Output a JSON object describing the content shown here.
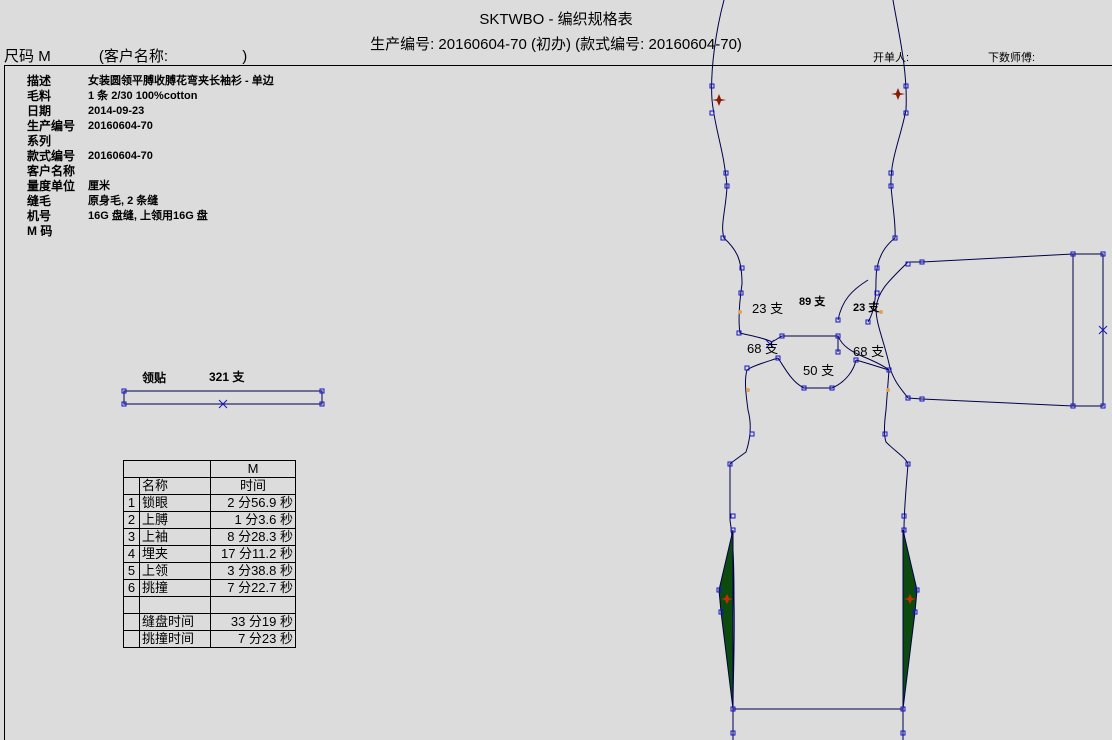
{
  "header": {
    "title": "SKTWBO - 编织规格表",
    "subtitle": "生产编号: 20160604-70 (初办)  (款式编号: 20160604-70)",
    "size_label": "尺码",
    "size_value": "M",
    "customer_label": "(客户名称:",
    "customer_close": ")",
    "opener": "开单人:",
    "master": "下数师傅:"
  },
  "info": [
    {
      "label": "描述",
      "value": "女装圆领平膊收膊花弯夹长袖衫 - 单边"
    },
    {
      "label": "毛料",
      "value": "1 条 2/30 100%cotton"
    },
    {
      "label": "日期",
      "value": "2014-09-23"
    },
    {
      "label": "生产编号",
      "value": "20160604-70"
    },
    {
      "label": "系列",
      "value": ""
    },
    {
      "label": "款式编号",
      "value": "20160604-70"
    },
    {
      "label": "客户名称",
      "value": ""
    },
    {
      "label": "量度单位",
      "value": "厘米"
    },
    {
      "label": "缝毛",
      "value": "原身毛, 2 条缝"
    },
    {
      "label": "机号",
      "value": "16G 盘缝, 上领用16G 盘"
    },
    {
      "label": "M 码",
      "value": ""
    }
  ],
  "collar": {
    "label": "领贴",
    "count": "321 支"
  },
  "time_table": {
    "size_header": "M",
    "col_name": "名称",
    "col_time": "时间",
    "rows": [
      {
        "idx": "1",
        "name": "锁眼",
        "time": "2 分56.9 秒"
      },
      {
        "idx": "2",
        "name": "上膊",
        "time": "1 分3.6 秒"
      },
      {
        "idx": "3",
        "name": "上袖",
        "time": "8 分28.3 秒"
      },
      {
        "idx": "4",
        "name": "埋夹",
        "time": "17 分11.2 秒"
      },
      {
        "idx": "5",
        "name": "上领",
        "time": "3 分38.8 秒"
      },
      {
        "idx": "6",
        "name": "挑撞",
        "time": "7 分22.7 秒"
      }
    ],
    "totals": [
      {
        "name": "缝盘时间",
        "time": "33 分19 秒"
      },
      {
        "name": "挑撞时间",
        "time": "7 分23 秒"
      }
    ]
  },
  "pattern_labels": {
    "left_armhole": "23 支",
    "neck_top": "89 支",
    "right_armhole": "23 支",
    "left_shoulder": "68 支",
    "right_shoulder": "68 支",
    "neck_bottom": "50 支"
  },
  "colors": {
    "outline": "#00004a",
    "node": "#1414c8",
    "fill_panel": "#0d4a0d",
    "marker": "#8b1a00",
    "seam_dot": "#e0a060"
  }
}
